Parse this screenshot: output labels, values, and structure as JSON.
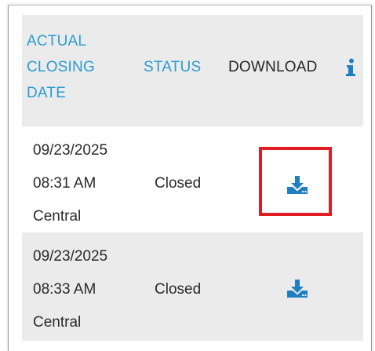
{
  "table": {
    "headers": {
      "closing_date_line1": "ACTUAL",
      "closing_date_line2": "CLOSING",
      "closing_date_line3": "DATE",
      "status": "STATUS",
      "download": "DOWNLOAD"
    },
    "rows": [
      {
        "date": "09/23/2025",
        "time": "08:31 AM",
        "zone": "Central",
        "status": "Closed",
        "download_icon": "download-icon",
        "highlighted": true
      },
      {
        "date": "09/23/2025",
        "time": "08:33 AM",
        "zone": "Central",
        "status": "Closed",
        "download_icon": "download-icon",
        "highlighted": false
      }
    ]
  },
  "icons": {
    "info": "info-icon",
    "download": "download-icon"
  },
  "colors": {
    "header_link": "#2a9bd1",
    "header_bg": "#ebebeb",
    "download_icon": "#1f7fc2",
    "highlight_border": "#e11d24"
  }
}
